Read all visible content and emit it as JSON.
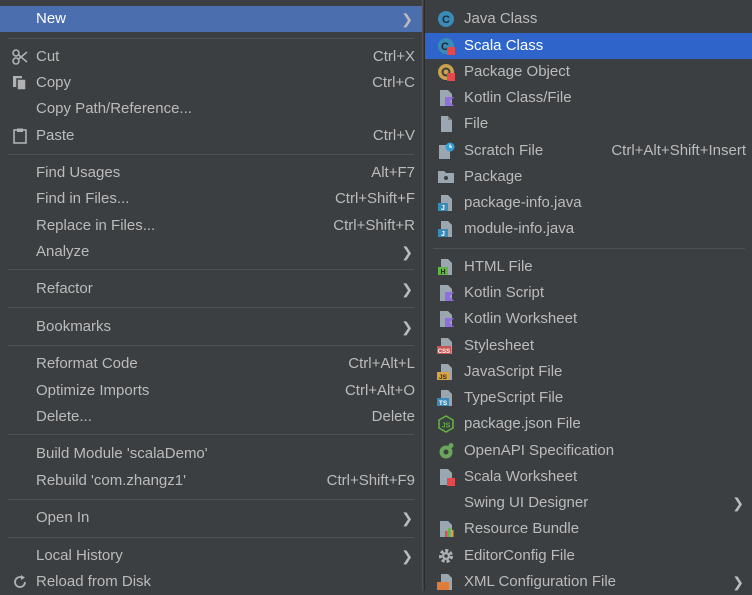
{
  "main_menu": {
    "new": "New",
    "cut": {
      "label": "Cut",
      "shortcut": "Ctrl+X"
    },
    "copy": {
      "label": "Copy",
      "shortcut": "Ctrl+C"
    },
    "copy_path": "Copy Path/Reference...",
    "paste": {
      "label": "Paste",
      "shortcut": "Ctrl+V"
    },
    "find_usages": {
      "label": "Find Usages",
      "shortcut": "Alt+F7"
    },
    "find_in_files": {
      "label": "Find in Files...",
      "shortcut": "Ctrl+Shift+F"
    },
    "replace_in_files": {
      "label": "Replace in Files...",
      "shortcut": "Ctrl+Shift+R"
    },
    "analyze": "Analyze",
    "refactor": "Refactor",
    "bookmarks": "Bookmarks",
    "reformat_code": {
      "label": "Reformat Code",
      "shortcut": "Ctrl+Alt+L"
    },
    "optimize_imports": {
      "label": "Optimize Imports",
      "shortcut": "Ctrl+Alt+O"
    },
    "delete": {
      "label": "Delete...",
      "shortcut": "Delete"
    },
    "build_module": "Build Module 'scalaDemo'",
    "rebuild": {
      "label": "Rebuild 'com.zhangz1'",
      "shortcut": "Ctrl+Shift+F9"
    },
    "open_in": "Open In",
    "local_history": "Local History",
    "reload_from_disk": "Reload from Disk"
  },
  "new_menu": {
    "java_class": "Java Class",
    "scala_class": "Scala Class",
    "package_object": "Package Object",
    "kotlin_class": "Kotlin Class/File",
    "file": "File",
    "scratch_file": {
      "label": "Scratch File",
      "shortcut": "Ctrl+Alt+Shift+Insert"
    },
    "package": "Package",
    "package_info": "package-info.java",
    "module_info": "module-info.java",
    "html_file": "HTML File",
    "kotlin_script": "Kotlin Script",
    "kotlin_worksheet": "Kotlin Worksheet",
    "stylesheet": "Stylesheet",
    "javascript_file": "JavaScript File",
    "typescript_file": "TypeScript File",
    "package_json": "package.json File",
    "openapi": "OpenAPI Specification",
    "scala_worksheet": "Scala Worksheet",
    "swing_ui": "Swing UI Designer",
    "resource_bundle": "Resource Bundle",
    "editorconfig": "EditorConfig File",
    "xml_config": "XML Configuration File"
  },
  "icons": {
    "css_badge": "CSS",
    "js_badge": "JS",
    "ts_badge": "TS",
    "html_badge": "H",
    "java_badge": "J"
  },
  "colors": {
    "background": "#3c3f41",
    "selection": "#4b6eaf",
    "highlight": "#2f65ca",
    "text": "#bbbbbb"
  }
}
